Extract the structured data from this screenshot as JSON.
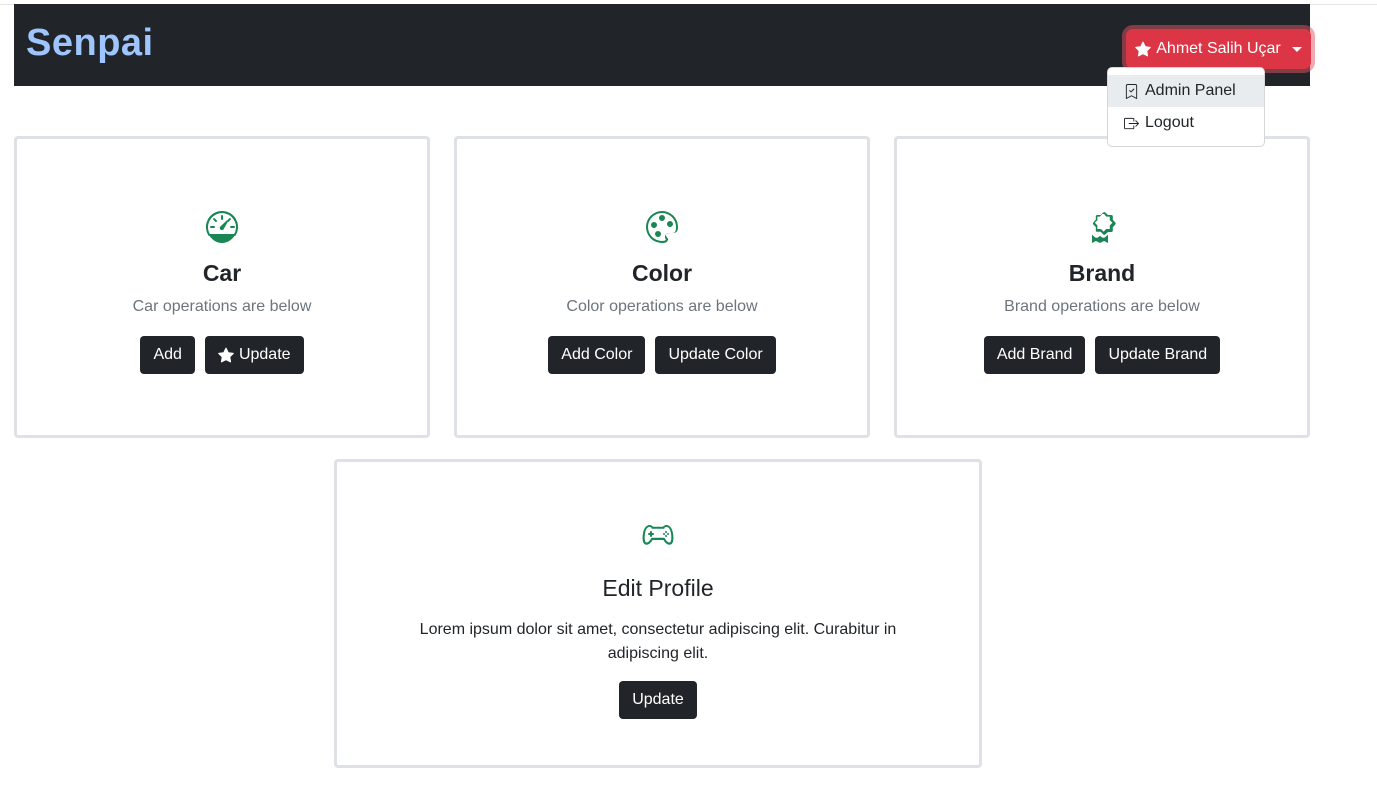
{
  "navbar": {
    "brand": "Senpai",
    "user_name": "Ahmet Salih Uçar"
  },
  "dropdown": {
    "items": [
      {
        "label": "Admin Panel",
        "icon": "bookmark-icon"
      },
      {
        "label": "Logout",
        "icon": "box-arrow-right-icon"
      }
    ]
  },
  "cards": [
    {
      "icon": "speedometer-icon",
      "title": "Car",
      "subtitle": "Car operations are below",
      "buttons": [
        "Add",
        "Update"
      ]
    },
    {
      "icon": "palette-icon",
      "title": "Color",
      "subtitle": "Color operations are below",
      "buttons": [
        "Add Color",
        "Update Color"
      ]
    },
    {
      "icon": "award-icon",
      "title": "Brand",
      "subtitle": "Brand operations are below",
      "buttons": [
        "Add Brand",
        "Update Brand"
      ]
    }
  ],
  "profile": {
    "icon": "controller-icon",
    "title": "Edit Profile",
    "text": "Lorem ipsum dolor sit amet, consectetur adipiscing elit. Curabitur in adipiscing elit.",
    "button": "Update"
  },
  "colors": {
    "navbar_bg": "#212529",
    "brand_text": "#9ec5fe",
    "user_button": "#dc3545",
    "icon_green": "#198754",
    "button_dark": "#212529"
  }
}
